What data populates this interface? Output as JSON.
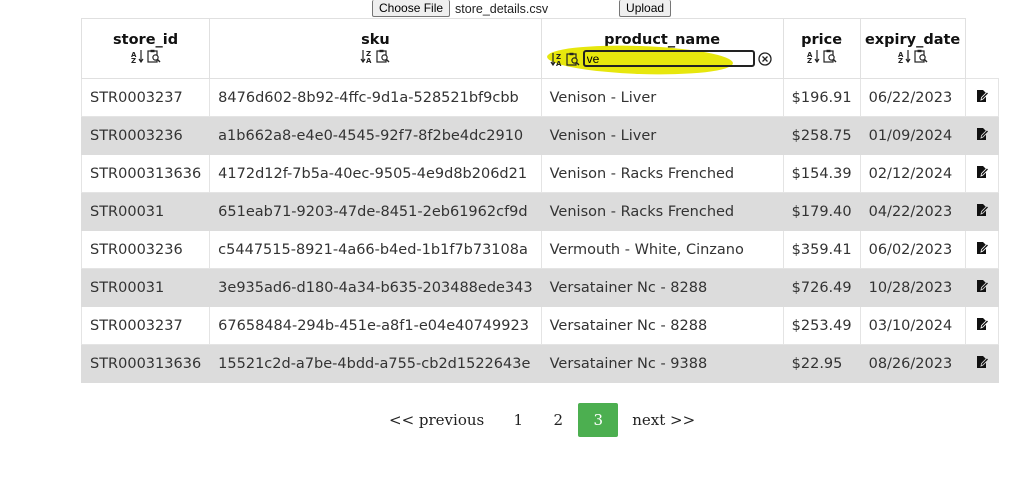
{
  "upload": {
    "choose_label": "Choose File",
    "file_name": "store_details.csv",
    "upload_label": "Upload"
  },
  "columns": {
    "store_id": "store_id",
    "sku": "sku",
    "product_name": "product_name",
    "price": "price",
    "expiry_date": "expiry_date"
  },
  "filter": {
    "product_name_value": "ve"
  },
  "rows": [
    {
      "store_id": "STR0003237",
      "sku": "8476d602-8b92-4ffc-9d1a-528521bf9cbb",
      "product_name": "Venison - Liver",
      "price": "$196.91",
      "expiry_date": "06/22/2023"
    },
    {
      "store_id": "STR0003236",
      "sku": "a1b662a8-e4e0-4545-92f7-8f2be4dc2910",
      "product_name": "Venison - Liver",
      "price": "$258.75",
      "expiry_date": "01/09/2024"
    },
    {
      "store_id": "STR000313636",
      "sku": "4172d12f-7b5a-40ec-9505-4e9d8b206d21",
      "product_name": "Venison - Racks Frenched",
      "price": "$154.39",
      "expiry_date": "02/12/2024"
    },
    {
      "store_id": "STR00031",
      "sku": "651eab71-9203-47de-8451-2eb61962cf9d",
      "product_name": "Venison - Racks Frenched",
      "price": "$179.40",
      "expiry_date": "04/22/2023"
    },
    {
      "store_id": "STR0003236",
      "sku": "c5447515-8921-4a66-b4ed-1b1f7b73108a",
      "product_name": "Vermouth - White, Cinzano",
      "price": "$359.41",
      "expiry_date": "06/02/2023"
    },
    {
      "store_id": "STR00031",
      "sku": "3e935ad6-d180-4a34-b635-203488ede343",
      "product_name": "Versatainer Nc - 8288",
      "price": "$726.49",
      "expiry_date": "10/28/2023"
    },
    {
      "store_id": "STR0003237",
      "sku": "67658484-294b-451e-a8f1-e04e40749923",
      "product_name": "Versatainer Nc - 8288",
      "price": "$253.49",
      "expiry_date": "03/10/2024"
    },
    {
      "store_id": "STR000313636",
      "sku": "15521c2d-a7be-4bdd-a755-cb2d1522643e",
      "product_name": "Versatainer Nc - 9388",
      "price": "$22.95",
      "expiry_date": "08/26/2023"
    }
  ],
  "pagination": {
    "previous_label": "<< previous",
    "pages": [
      "1",
      "2",
      "3"
    ],
    "current_page": "3",
    "next_label": "next >>"
  },
  "colors": {
    "active_page": "#4caf50",
    "filter_highlight": "#e6e600",
    "alt_row": "#dcdcdc"
  },
  "icons": [
    "sort-az-icon",
    "sort-za-icon",
    "filter-icon",
    "clear-icon",
    "edit-icon"
  ]
}
